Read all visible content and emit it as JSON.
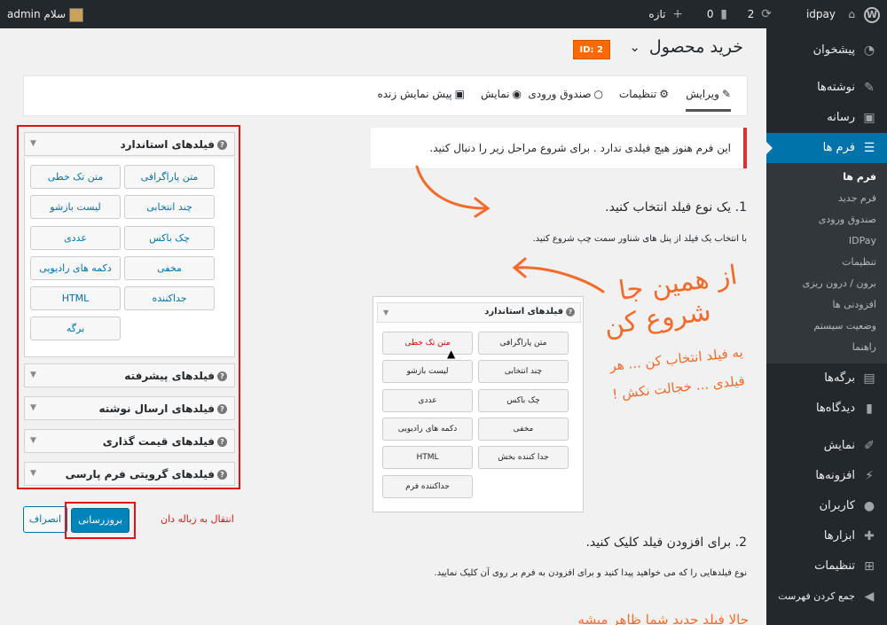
{
  "adminbar": {
    "site_name": "idpay",
    "updates_count": "2",
    "comments_count": "0",
    "new_label": "تازه",
    "greeting": "سلام admin"
  },
  "menu": {
    "dashboard": "پیشخوان",
    "posts": "نوشته‌ها",
    "media": "رسانه",
    "forms": "فرم ها",
    "sub": [
      "فرم ها",
      "فرم جدید",
      "صندوق ورودی",
      "IDPay",
      "تنظیمات",
      "برون / درون ریزی",
      "افزودنی ها",
      "وضعیت سیستم",
      "راهنما"
    ],
    "pages": "برگه‌ها",
    "comments": "دیدگاه‌ها",
    "appearance": "نمایش",
    "plugins": "افزونه‌ها",
    "users": "کاربران",
    "tools": "ابزارها",
    "settings": "تنظیمات",
    "collapse": "جمع کردن فهرست"
  },
  "form": {
    "title": "خرید محصول",
    "id_badge": "ID: 2"
  },
  "tabs": {
    "edit": "ویرایش",
    "settings": "تنظیمات",
    "inbox": "صندوق ورودی",
    "display": "نمایش",
    "preview": "پیش نمایش زنده"
  },
  "fields": {
    "standard_title": "فیلدهای استاندارد",
    "buttons": [
      "متن پاراگرافی",
      "متن تک خطی",
      "چند انتخابی",
      "لیست بازشو",
      "چک باکس",
      "عددی",
      "مخفی",
      "دکمه های رادیویی",
      "جداکننده",
      "HTML",
      "برگه"
    ],
    "advanced_title": "فیلدهای پیشرفته",
    "post_title": "فیلدهای ارسال نوشته",
    "pricing_title": "فیلدهای قیمت گذاری",
    "persian_title": "فیلدهای گرویتی فرم پارسی"
  },
  "actions": {
    "update": "بروزرسانی",
    "cancel": "انصراف",
    "trash": "انتقال به زباله دان"
  },
  "instructions": {
    "notice": "این فرم هنوز هیچ فیلدی ندارد . برای شروع مراحل زیر را دنبال کنید.",
    "step1_title": "1. یک نوع فیلد انتخاب کنید.",
    "step1_desc": "با انتخاب یک فیلد از پنل های شناور سمت چپ شروع کنید.",
    "step2_title": "2. برای افزودن فیلد کلیک کنید.",
    "step2_desc": "نوع فیلدهایی را که می خواهید پیدا کنید و برای افزودن به فرم بر روی آن کلیک نمایید.",
    "illus_title": "فیلدهای استاندارد",
    "illus_buttons": [
      "متن پاراگرافی",
      "متن تک خطی",
      "چند انتخابی",
      "لیست بازشو",
      "چک باکس",
      "عددی",
      "مخفی",
      "دکمه های رادیویی",
      "جدا کننده بخش",
      "HTML",
      "جداکننده فرم"
    ]
  },
  "annotations": {
    "big_line1": "از همین جا",
    "big_line2": "شروع کن",
    "small_line1": "یه فیلد انتخاب کن ... هر",
    "small_line2": "فیلدی ... خجالت نکش !",
    "bottom": "حالا فیلد جدید شما ظاهر میشه"
  },
  "colors": {
    "accent": "#0073aa",
    "annotation": "#f26b2b",
    "highlight_border": "#e41313",
    "badge": "#ff6a00"
  }
}
